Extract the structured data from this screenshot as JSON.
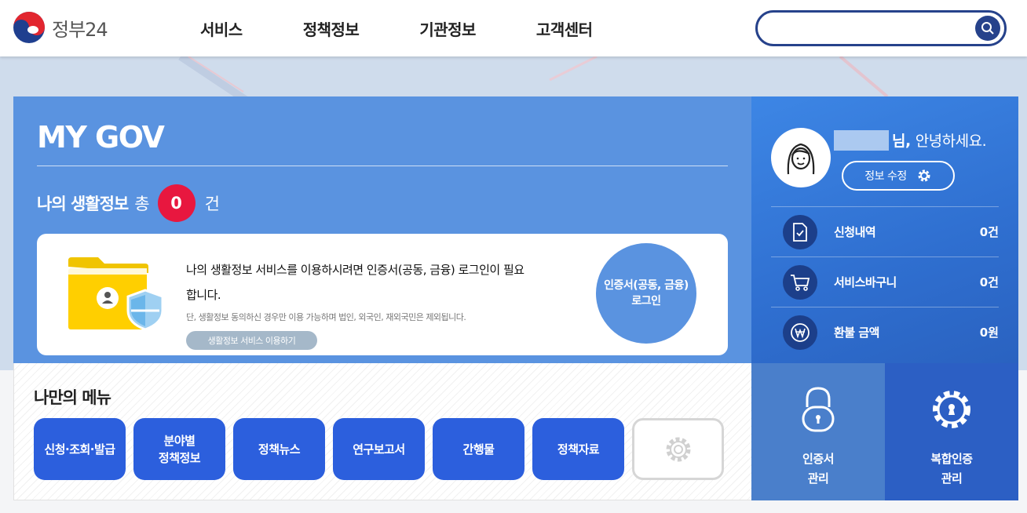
{
  "header": {
    "logo_text": "정부24",
    "nav": [
      "서비스",
      "정책정보",
      "기관정보",
      "고객센터"
    ],
    "search": {
      "value": "",
      "placeholder": ""
    }
  },
  "mygov": {
    "title": "MY GOV",
    "life_label": "나의 생활정보",
    "life_total": "총",
    "life_count": "0",
    "life_unit": "건",
    "info_line1": "나의 생활정보 서비스를 이용하시려면 인증서(공동, 금융) 로그인이 필요",
    "info_line2": "합니다.",
    "info_note": "단, 생활정보 동의하신 경우만 이용 가능하며 법인, 외국인, 재외국민은 제외됩니다.",
    "info_button": "생활정보 서비스 이용하기",
    "cert_login_line1": "인증서(공동, 금융)",
    "cert_login_line2": "로그인"
  },
  "profile": {
    "name_suffix": "님,",
    "greeting": "안녕하세요.",
    "edit_button": "정보 수정",
    "stats": [
      {
        "label": "신청내역",
        "value": "0건",
        "icon": "document-check-icon"
      },
      {
        "label": "서비스바구니",
        "value": "0건",
        "icon": "cart-icon"
      },
      {
        "label": "환불 금액",
        "value": "0원",
        "icon": "won-icon"
      }
    ]
  },
  "mymenu": {
    "title": "나만의 메뉴",
    "items": [
      {
        "line1": "신청·조회·발급",
        "line2": ""
      },
      {
        "line1": "분야별",
        "line2": "정책정보"
      },
      {
        "line1": "정책뉴스",
        "line2": ""
      },
      {
        "line1": "연구보고서",
        "line2": ""
      },
      {
        "line1": "간행물",
        "line2": ""
      },
      {
        "line1": "정책자료",
        "line2": ""
      }
    ]
  },
  "tiles": {
    "cert": {
      "line1": "인증서",
      "line2": "관리"
    },
    "multi": {
      "line1": "복합인증",
      "line2": "관리"
    }
  },
  "colors": {
    "brand_navy": "#26428b",
    "mygov_blue": "#5a93e0",
    "badge_red": "#e8173f",
    "menu_blue": "#2c5fdd"
  }
}
